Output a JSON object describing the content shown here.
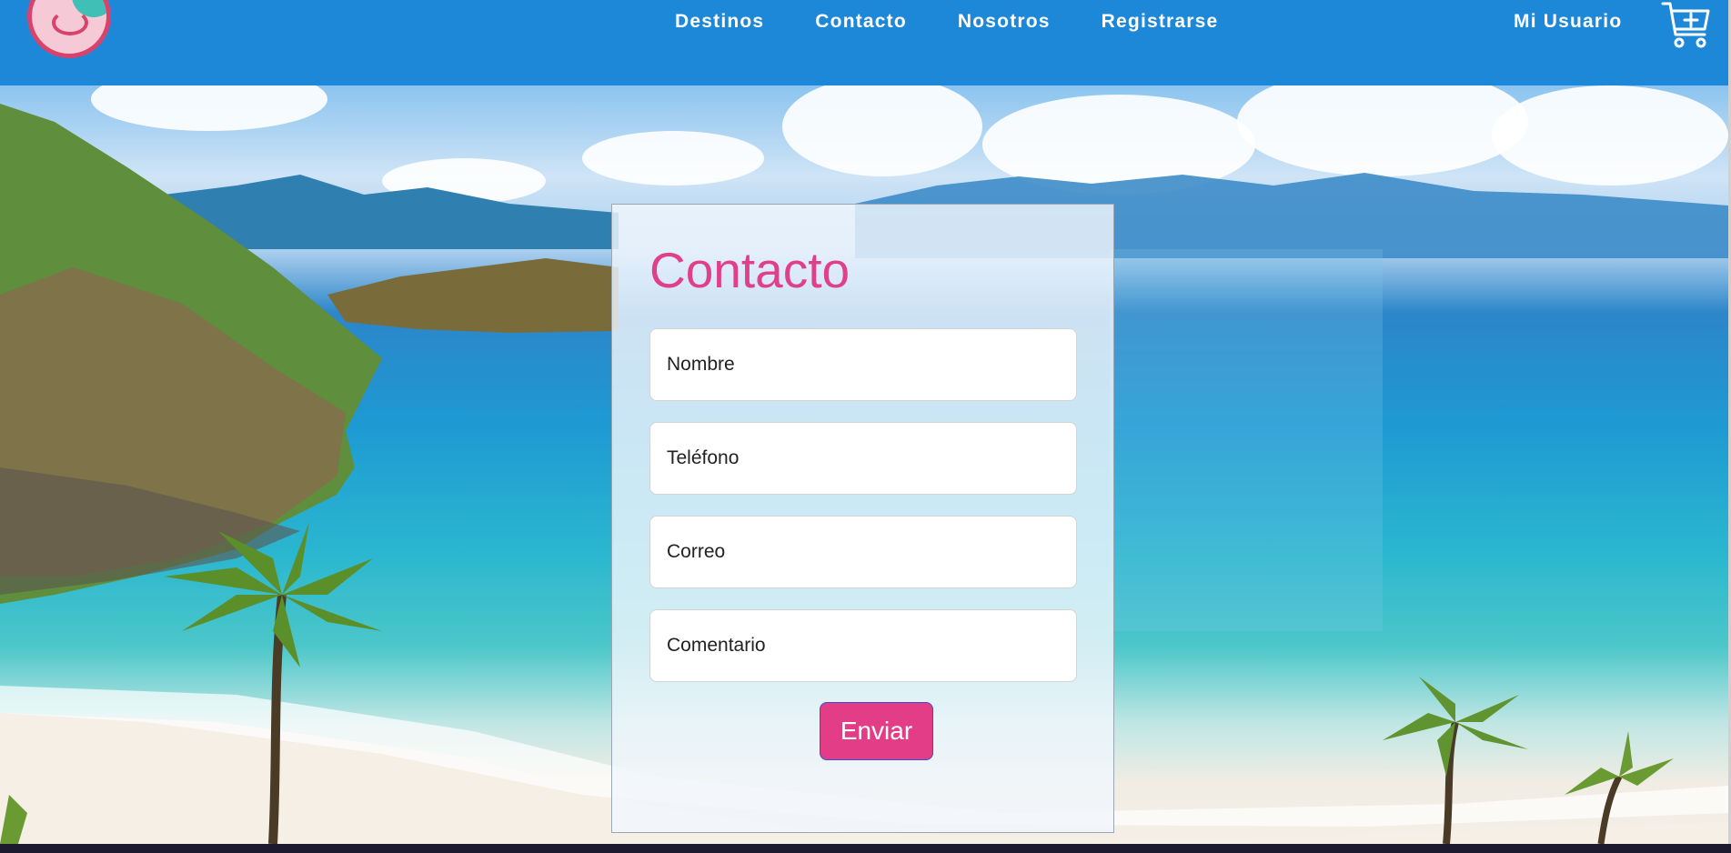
{
  "header": {
    "nav": [
      "Destinos",
      "Contacto",
      "Nosotros",
      "Registrarse"
    ],
    "user_label": "Mi Usuario",
    "cart_icon": "cart-plus-icon",
    "logo_icon": "logo-icon",
    "colors": {
      "navbar": "#1e88d8",
      "text": "#ffffff"
    }
  },
  "contact_form": {
    "title": "Contacto",
    "fields": {
      "name_placeholder": "Nombre",
      "phone_placeholder": "Teléfono",
      "email_placeholder": "Correo",
      "comment_placeholder": "Comentario"
    },
    "submit_label": "Enviar",
    "colors": {
      "title": "#e0408a",
      "button": "#e23d86"
    }
  }
}
